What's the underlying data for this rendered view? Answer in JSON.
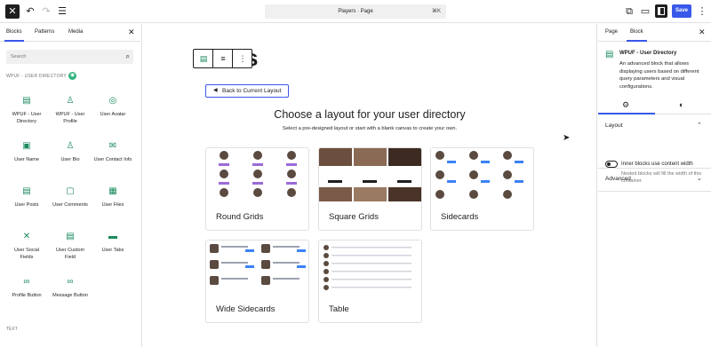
{
  "topbar": {
    "close_icon": "close-icon",
    "command_label": "Players · Page",
    "command_shortcut": "⌘K",
    "save_label": "Save"
  },
  "inserter": {
    "tabs": [
      "Blocks",
      "Patterns",
      "Media"
    ],
    "search_placeholder": "Search",
    "category_label": "WPUF - USER DIRECTORY",
    "category_badge": "",
    "blocks": [
      {
        "label": "WPUF - User Directory",
        "icon": "list-icon"
      },
      {
        "label": "WPUF - User Profile",
        "icon": "person-icon"
      },
      {
        "label": "User Avatar",
        "icon": "avatar-icon"
      },
      {
        "label": "User Name",
        "icon": "id-card-icon"
      },
      {
        "label": "User Bio",
        "icon": "person-icon"
      },
      {
        "label": "User Contact Info",
        "icon": "envelope-icon"
      },
      {
        "label": "User Posts",
        "icon": "list-icon"
      },
      {
        "label": "User Comments",
        "icon": "comment-icon"
      },
      {
        "label": "User Files",
        "icon": "file-icon"
      },
      {
        "label": "User Social Fields",
        "icon": "share-icon"
      },
      {
        "label": "User Custom Field",
        "icon": "list-icon"
      },
      {
        "label": "User Tabs",
        "icon": "tabs-icon"
      },
      {
        "label": "Profile Button",
        "icon": "link-icon"
      },
      {
        "label": "Message Button",
        "icon": "link-icon"
      }
    ],
    "bottom_category": "TEXT"
  },
  "canvas": {
    "background_title": "s",
    "back_button_label": "Back to Current Layout",
    "heading": "Choose a layout for your user directory",
    "subheading": "Select a pre-designed layout or start with a blank canvas to create your own.",
    "layouts": [
      {
        "label": "Round Grids"
      },
      {
        "label": "Square Grids"
      },
      {
        "label": "Sidecards"
      },
      {
        "label": "Wide Sidecards"
      },
      {
        "label": "Table"
      }
    ]
  },
  "settings": {
    "tabs": [
      "Page",
      "Block"
    ],
    "block_title": "WPUF - User Directory",
    "block_description": "An advanced block that allows displaying users based on different query parameters and visual configurations.",
    "layout_section": "Layout",
    "toggle_label": "Inner blocks use content width",
    "toggle_help": "Nested blocks will fill the width of this container.",
    "advanced_section": "Advanced"
  },
  "colors": {
    "accent": "#3858e9",
    "block_icon": "#1a8a5c",
    "badge": "#2db27d"
  }
}
